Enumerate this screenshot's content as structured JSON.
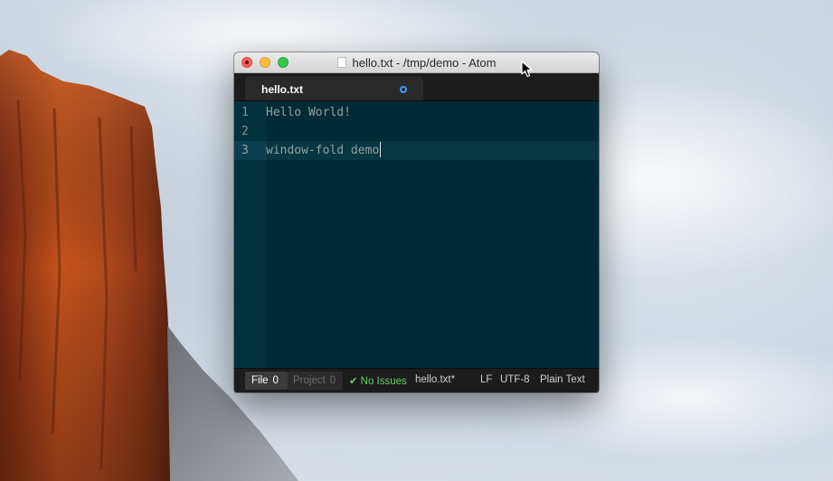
{
  "window": {
    "title": "hello.txt - /tmp/demo - Atom"
  },
  "tabs": [
    {
      "label": "hello.txt",
      "modified": true
    }
  ],
  "editor": {
    "lines": [
      {
        "number": "1",
        "text": "Hello World!"
      },
      {
        "number": "2",
        "text": ""
      },
      {
        "number": "3",
        "text": "window-fold demo",
        "active": true
      }
    ]
  },
  "statusbar": {
    "file_label": "File",
    "file_count": "0",
    "project_label": "Project",
    "project_count": "0",
    "issues": "No Issues",
    "filename": "hello.txt*",
    "line_ending": "LF",
    "encoding": "UTF-8",
    "grammar": "Plain Text"
  },
  "colors": {
    "editor_bg": "#002b36",
    "gutter_bg": "#00313d",
    "active_line": "#073642",
    "text": "#93a1a1",
    "modified_dot": "#3aa0ff",
    "issues_ok": "#5fd35f"
  },
  "icons": {
    "close": "close-icon",
    "minimize": "minimize-icon",
    "maximize": "maximize-icon",
    "document": "document-icon",
    "check": "check-icon",
    "cursor": "mouse-pointer-icon"
  }
}
